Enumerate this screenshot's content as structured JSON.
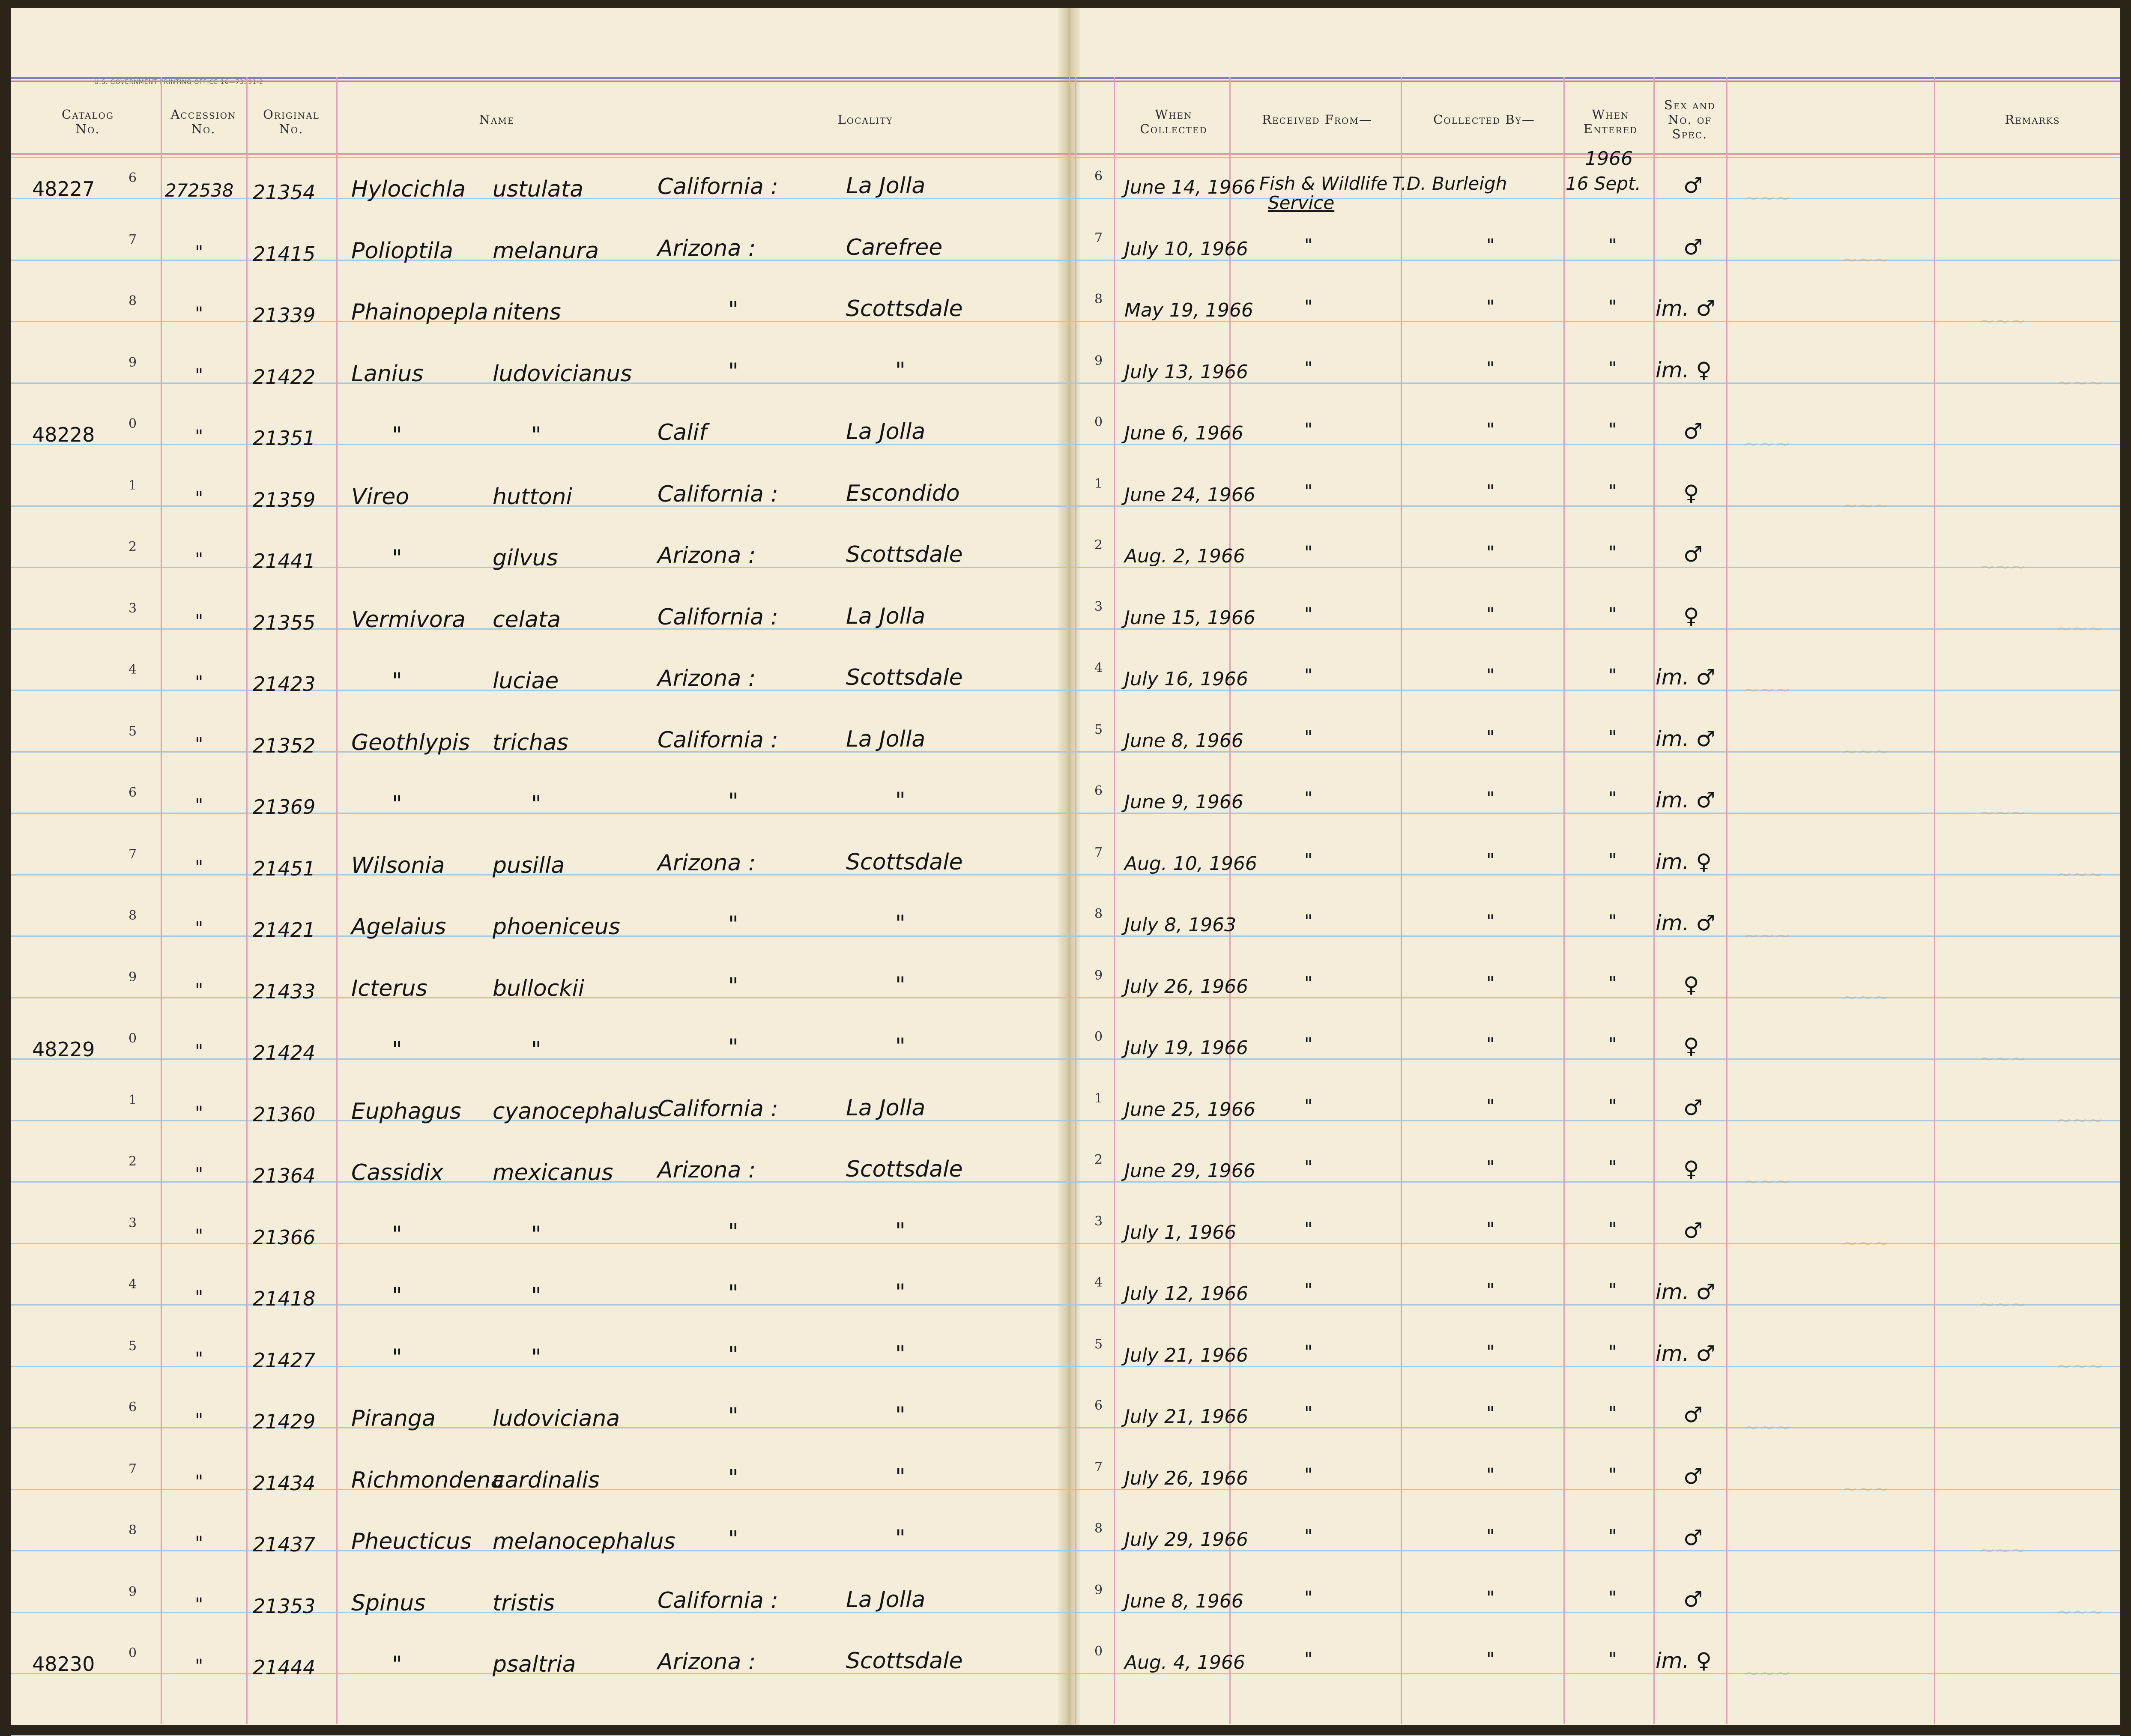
{
  "header": {
    "printer": "U.S. GOVERNMENT PRINTING OFFICE 16—73391-2",
    "columns": [
      {
        "key": "catalog",
        "label": "Catalog\nNo."
      },
      {
        "key": "accession",
        "label": "Accession\nNo."
      },
      {
        "key": "original",
        "label": "Original\nNo."
      },
      {
        "key": "name",
        "label": "Name"
      },
      {
        "key": "locality",
        "label": "Locality"
      },
      {
        "key": "when_collected",
        "label": "When\nCollected"
      },
      {
        "key": "received_from",
        "label": "Received From—"
      },
      {
        "key": "collected_by",
        "label": "Collected By—"
      },
      {
        "key": "when_entered",
        "label": "When\nEntered"
      },
      {
        "key": "sex",
        "label": "Sex and\nNo. of\nSpec."
      },
      {
        "key": "remarks",
        "label": "Remarks"
      }
    ],
    "year_entered": "1966"
  },
  "rows": [
    {
      "cat": "48227",
      "d": "6",
      "acc": "272538",
      "orig": "21354",
      "genus": "Hylocichla",
      "species": "ustulata",
      "state": "California :",
      "place": "La Jolla",
      "rd": "6",
      "date": "June 14, 1966",
      "recv": "Fish & Wildlife",
      "recv2": "Service",
      "coll": "T.D. Burleigh",
      "ent": "16 Sept.",
      "sex": "♂"
    },
    {
      "cat": "",
      "d": "7",
      "acc": "\"",
      "orig": "21415",
      "genus": "Polioptila",
      "species": "melanura",
      "state": "Arizona :",
      "place": "Carefree",
      "rd": "7",
      "date": "July 10, 1966",
      "recv": "\"",
      "coll": "\"",
      "ent": "\"",
      "sex": "♂"
    },
    {
      "cat": "",
      "d": "8",
      "acc": "\"",
      "orig": "21339",
      "genus": "Phainopepla",
      "species": "nitens",
      "state": "\"",
      "place": "Scottsdale",
      "rd": "8",
      "date": "May 19, 1966",
      "recv": "\"",
      "coll": "\"",
      "ent": "\"",
      "sex": "im. ♂"
    },
    {
      "cat": "",
      "d": "9",
      "acc": "\"",
      "orig": "21422",
      "genus": "Lanius",
      "species": "ludovicianus",
      "state": "\"",
      "place": "\"",
      "rd": "9",
      "date": "July 13, 1966",
      "recv": "\"",
      "coll": "\"",
      "ent": "\"",
      "sex": "im. ♀"
    },
    {
      "cat": "48228",
      "d": "0",
      "acc": "\"",
      "orig": "21351",
      "genus": "\"",
      "species": "\"",
      "state": "Calif",
      "place": "La Jolla",
      "rd": "0",
      "date": "June 6, 1966",
      "recv": "\"",
      "coll": "\"",
      "ent": "\"",
      "sex": "♂"
    },
    {
      "cat": "",
      "d": "1",
      "acc": "\"",
      "orig": "21359",
      "genus": "Vireo",
      "species": "huttoni",
      "state": "California :",
      "place": "Escondido",
      "rd": "1",
      "date": "June 24, 1966",
      "recv": "\"",
      "coll": "\"",
      "ent": "\"",
      "sex": "♀"
    },
    {
      "cat": "",
      "d": "2",
      "acc": "\"",
      "orig": "21441",
      "genus": "\"",
      "species": "gilvus",
      "state": "Arizona :",
      "place": "Scottsdale",
      "rd": "2",
      "date": "Aug. 2, 1966",
      "recv": "\"",
      "coll": "\"",
      "ent": "\"",
      "sex": "♂"
    },
    {
      "cat": "",
      "d": "3",
      "acc": "\"",
      "orig": "21355",
      "genus": "Vermivora",
      "species": "celata",
      "state": "California :",
      "place": "La Jolla",
      "rd": "3",
      "date": "June 15, 1966",
      "recv": "\"",
      "coll": "\"",
      "ent": "\"",
      "sex": "♀"
    },
    {
      "cat": "",
      "d": "4",
      "acc": "\"",
      "orig": "21423",
      "genus": "\"",
      "species": "luciae",
      "state": "Arizona :",
      "place": "Scottsdale",
      "rd": "4",
      "date": "July 16, 1966",
      "recv": "\"",
      "coll": "\"",
      "ent": "\"",
      "sex": "im. ♂"
    },
    {
      "cat": "",
      "d": "5",
      "acc": "\"",
      "orig": "21352",
      "genus": "Geothlypis",
      "species": "trichas",
      "state": "California :",
      "place": "La Jolla",
      "rd": "5",
      "date": "June 8, 1966",
      "recv": "\"",
      "coll": "\"",
      "ent": "\"",
      "sex": "im. ♂"
    },
    {
      "cat": "",
      "d": "6",
      "acc": "\"",
      "orig": "21369",
      "genus": "\"",
      "species": "\"",
      "state": "\"",
      "place": "\"",
      "rd": "6",
      "date": "June 9, 1966",
      "recv": "\"",
      "coll": "\"",
      "ent": "\"",
      "sex": "im. ♂"
    },
    {
      "cat": "",
      "d": "7",
      "acc": "\"",
      "orig": "21451",
      "genus": "Wilsonia",
      "species": "pusilla",
      "state": "Arizona :",
      "place": "Scottsdale",
      "rd": "7",
      "date": "Aug. 10, 1966",
      "recv": "\"",
      "coll": "\"",
      "ent": "\"",
      "sex": "im. ♀"
    },
    {
      "cat": "",
      "d": "8",
      "acc": "\"",
      "orig": "21421",
      "genus": "Agelaius",
      "species": "phoeniceus",
      "state": "\"",
      "place": "\"",
      "rd": "8",
      "date": "July 8, 1963",
      "recv": "\"",
      "coll": "\"",
      "ent": "\"",
      "sex": "im. ♂"
    },
    {
      "cat": "",
      "d": "9",
      "acc": "\"",
      "orig": "21433",
      "genus": "Icterus",
      "species": "bullockii",
      "state": "\"",
      "place": "\"",
      "rd": "9",
      "date": "July 26, 1966",
      "recv": "\"",
      "coll": "\"",
      "ent": "\"",
      "sex": "♀"
    },
    {
      "cat": "48229",
      "d": "0",
      "acc": "\"",
      "orig": "21424",
      "genus": "\"",
      "species": "\"",
      "state": "\"",
      "place": "\"",
      "rd": "0",
      "date": "July 19, 1966",
      "recv": "\"",
      "coll": "\"",
      "ent": "\"",
      "sex": "♀"
    },
    {
      "cat": "",
      "d": "1",
      "acc": "\"",
      "orig": "21360",
      "genus": "Euphagus",
      "species": "cyanocephalus",
      "state": "California :",
      "place": "La Jolla",
      "rd": "1",
      "date": "June 25, 1966",
      "recv": "\"",
      "coll": "\"",
      "ent": "\"",
      "sex": "♂"
    },
    {
      "cat": "",
      "d": "2",
      "acc": "\"",
      "orig": "21364",
      "genus": "Cassidix",
      "species": "mexicanus",
      "state": "Arizona :",
      "place": "Scottsdale",
      "rd": "2",
      "date": "June 29, 1966",
      "recv": "\"",
      "coll": "\"",
      "ent": "\"",
      "sex": "♀"
    },
    {
      "cat": "",
      "d": "3",
      "acc": "\"",
      "orig": "21366",
      "genus": "\"",
      "species": "\"",
      "state": "\"",
      "place": "\"",
      "rd": "3",
      "date": "July 1, 1966",
      "recv": "\"",
      "coll": "\"",
      "ent": "\"",
      "sex": "♂"
    },
    {
      "cat": "",
      "d": "4",
      "acc": "\"",
      "orig": "21418",
      "genus": "\"",
      "species": "\"",
      "state": "\"",
      "place": "\"",
      "rd": "4",
      "date": "July 12, 1966",
      "recv": "\"",
      "coll": "\"",
      "ent": "\"",
      "sex": "im. ♂"
    },
    {
      "cat": "",
      "d": "5",
      "acc": "\"",
      "orig": "21427",
      "genus": "\"",
      "species": "\"",
      "state": "\"",
      "place": "\"",
      "rd": "5",
      "date": "July 21, 1966",
      "recv": "\"",
      "coll": "\"",
      "ent": "\"",
      "sex": "im. ♂"
    },
    {
      "cat": "",
      "d": "6",
      "acc": "\"",
      "orig": "21429",
      "genus": "Piranga",
      "species": "ludoviciana",
      "state": "\"",
      "place": "\"",
      "rd": "6",
      "date": "July 21, 1966",
      "recv": "\"",
      "coll": "\"",
      "ent": "\"",
      "sex": "♂"
    },
    {
      "cat": "",
      "d": "7",
      "acc": "\"",
      "orig": "21434",
      "genus": "Richmondena",
      "species": "cardinalis",
      "state": "\"",
      "place": "\"",
      "rd": "7",
      "date": "July 26, 1966",
      "recv": "\"",
      "coll": "\"",
      "ent": "\"",
      "sex": "♂"
    },
    {
      "cat": "",
      "d": "8",
      "acc": "\"",
      "orig": "21437",
      "genus": "Pheucticus",
      "species": "melanocephalus",
      "state": "\"",
      "place": "\"",
      "rd": "8",
      "date": "July 29, 1966",
      "recv": "\"",
      "coll": "\"",
      "ent": "\"",
      "sex": "♂"
    },
    {
      "cat": "",
      "d": "9",
      "acc": "\"",
      "orig": "21353",
      "genus": "Spinus",
      "species": "tristis",
      "state": "California :",
      "place": "La Jolla",
      "rd": "9",
      "date": "June 8, 1966",
      "recv": "\"",
      "coll": "\"",
      "ent": "\"",
      "sex": "♂"
    },
    {
      "cat": "48230",
      "d": "0",
      "acc": "\"",
      "orig": "21444",
      "genus": "\"",
      "species": "psaltria",
      "state": "Arizona :",
      "place": "Scottsdale",
      "rd": "0",
      "date": "Aug. 4, 1966",
      "recv": "\"",
      "coll": "\"",
      "ent": "\"",
      "sex": "im. ♀"
    }
  ]
}
